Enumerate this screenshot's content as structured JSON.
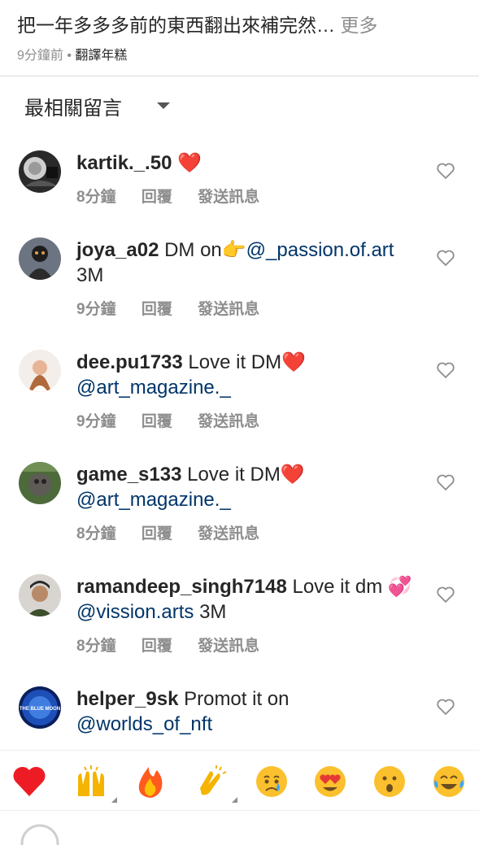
{
  "caption": {
    "text": "把一年多多多前的東西翻出來補完然…",
    "more_label": " 更多",
    "time": "9分鐘前",
    "dot": " • ",
    "translate_label": "翻譯年糕"
  },
  "sort": {
    "label": "最相關留言"
  },
  "comments": [
    {
      "user": "kartik._.50",
      "body": " ❤️",
      "mention": "",
      "tail": "",
      "time": "8分鐘",
      "reply": "回覆",
      "send": "發送訊息"
    },
    {
      "user": "joya_a02",
      "body": " DM on👉",
      "mention": "@_passion.of.art",
      "tail": " 3M",
      "time": "9分鐘",
      "reply": "回覆",
      "send": "發送訊息"
    },
    {
      "user": "dee.pu1733",
      "body": " Love it DM❤️ ",
      "mention": "@art_magazine._",
      "tail": "",
      "time": "9分鐘",
      "reply": "回覆",
      "send": "發送訊息"
    },
    {
      "user": "game_s133",
      "body": " Love it DM❤️ ",
      "mention": "@art_magazine._",
      "tail": "",
      "time": "8分鐘",
      "reply": "回覆",
      "send": "發送訊息"
    },
    {
      "user": "ramandeep_singh7148",
      "body": " Love it dm 💞 ",
      "mention": "@vission.arts",
      "tail": " 3M",
      "time": "8分鐘",
      "reply": "回覆",
      "send": "發送訊息"
    },
    {
      "user": "helper_9sk",
      "body": " Promot it on ",
      "mention": "@worlds_of_nft",
      "tail": "",
      "time": "",
      "reply": "",
      "send": ""
    }
  ],
  "avatar_labels": {
    "helper": "THE BLUE MOON"
  },
  "emoji_bar": [
    "❤️",
    "🙌",
    "🔥",
    "👏",
    "😢",
    "😍",
    "😮",
    "😂"
  ],
  "colors": {
    "mention": "#003569",
    "secondary": "#8e8e8e",
    "primary": "#262626",
    "heart_red": "#ed1c24"
  }
}
